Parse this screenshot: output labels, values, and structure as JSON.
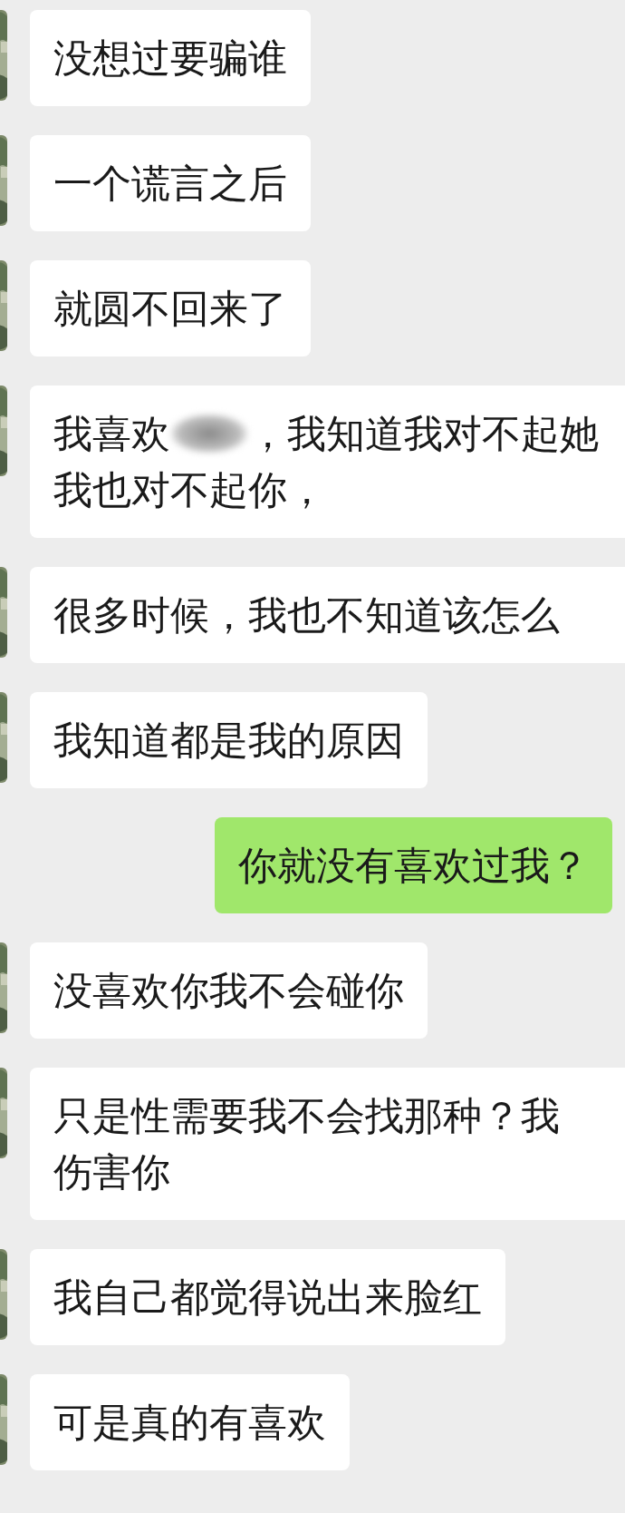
{
  "messages": [
    {
      "kind": "received",
      "lines": [
        "没想过要骗谁"
      ]
    },
    {
      "kind": "received",
      "lines": [
        "一个谎言之后"
      ]
    },
    {
      "kind": "received",
      "lines": [
        "就圆不回来了"
      ]
    },
    {
      "kind": "received",
      "cut": true,
      "lines": [
        [
          {
            "kind": "text",
            "text": "我喜欢"
          },
          {
            "kind": "blur"
          },
          {
            "kind": "text",
            "text": "，我知道我对不起她"
          }
        ],
        "我也对不起你，"
      ]
    },
    {
      "kind": "received",
      "cut": true,
      "lines": [
        "很多时候，我也不知道该怎么"
      ]
    },
    {
      "kind": "received",
      "lines": [
        "我知道都是我的原因"
      ]
    },
    {
      "kind": "sent",
      "lines": [
        "你就没有喜欢过我？"
      ]
    },
    {
      "kind": "received",
      "lines": [
        "没喜欢你我不会碰你"
      ]
    },
    {
      "kind": "received",
      "cut": true,
      "lines": [
        "只是性需要我不会找那种？我",
        "伤害你"
      ]
    },
    {
      "kind": "received",
      "lines": [
        "我自己都觉得说出来脸红"
      ]
    },
    {
      "kind": "received",
      "lines": [
        "可是真的有喜欢"
      ]
    }
  ]
}
